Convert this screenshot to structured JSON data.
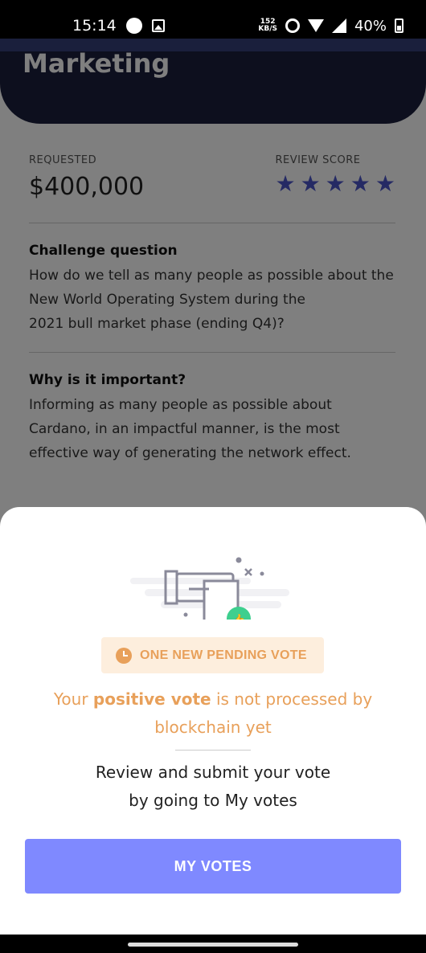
{
  "status_bar": {
    "time": "15:14",
    "net_speed_value": "152",
    "net_speed_unit": "KB/S",
    "battery": "40%"
  },
  "background": {
    "header_title": "Marketing",
    "requested_label": "REQUESTED",
    "requested_value": "$400,000",
    "review_score_label": "REVIEW SCORE",
    "review_score_stars": 5,
    "challenge_title": "Challenge question",
    "challenge_text_1": "How do we tell as many people as possible about the New World Operating System during the",
    "challenge_text_2": "2021 bull market phase (ending Q4)?",
    "importance_title": "Why is it important?",
    "importance_text": "Informing as many people as possible about Cardano, in an impactful manner, is the most effective way of generating the network effect."
  },
  "sheet": {
    "pending_badge": "ONE NEW PENDING VOTE",
    "notice_part1": "Your ",
    "notice_bold": "positive vote",
    "notice_part2": " is not processed by blockchain yet",
    "instruction_line1": "Review and submit your vote",
    "instruction_line2": "by going to My votes",
    "button_label": "MY VOTES"
  },
  "colors": {
    "accent": "#7f89ff",
    "warning": "#e8a05a",
    "thumbs_up": "#3ecf8e",
    "header": "#1a1f3c"
  }
}
